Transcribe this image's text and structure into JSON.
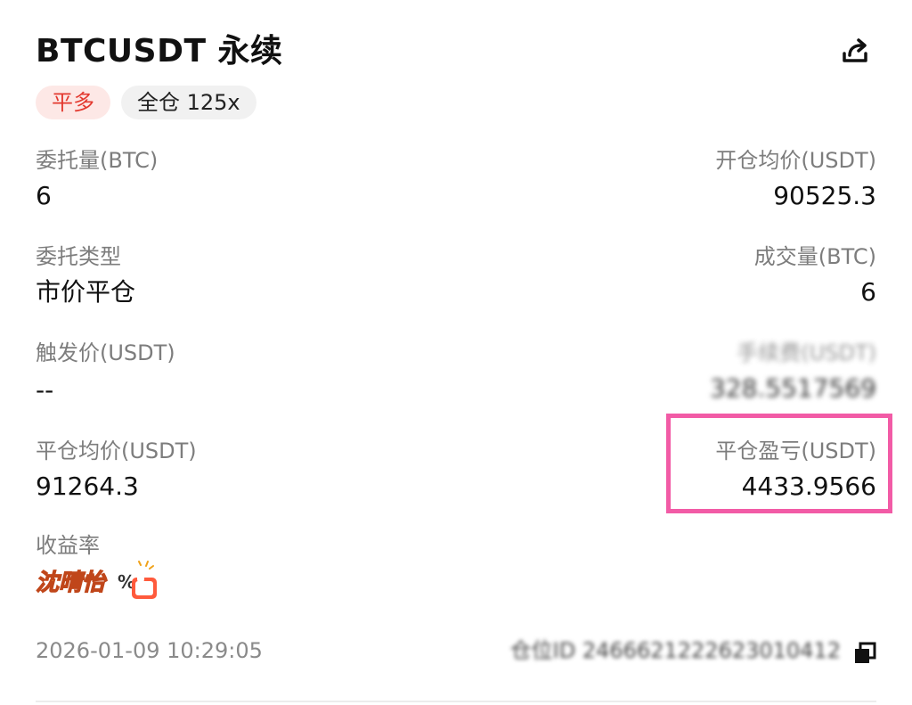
{
  "header": {
    "title": "BTCUSDT 永续",
    "share_icon": "share-icon"
  },
  "tags": {
    "side": "平多",
    "margin": "全仓 125x"
  },
  "fields": {
    "order_qty": {
      "label": "委托量(BTC)",
      "value": "6"
    },
    "open_avg": {
      "label": "开仓均价(USDT)",
      "value": "90525.3"
    },
    "order_type": {
      "label": "委托类型",
      "value": "市价平仓"
    },
    "filled_qty": {
      "label": "成交量(BTC)",
      "value": "6"
    },
    "trigger": {
      "label": "触发价(USDT)",
      "value": "--"
    },
    "fee": {
      "label": "手续费(USDT)",
      "value": "328.5517569"
    },
    "close_avg": {
      "label": "平仓均价(USDT)",
      "value": "91264.3"
    },
    "pnl": {
      "label": "平仓盈亏(USDT)",
      "value": "4433.9566"
    },
    "roi": {
      "label": "收益率",
      "sticker_text": "沈晴怡"
    }
  },
  "footer": {
    "time": "2026-01-09 10:29:05",
    "order_id": "仓位ID 2466621222623010412",
    "copy_icon": "copy-icon"
  },
  "colors": {
    "side_tag_bg": "#fde8e6",
    "side_tag_text": "#e3392f",
    "highlight_border": "#f25ba6"
  }
}
